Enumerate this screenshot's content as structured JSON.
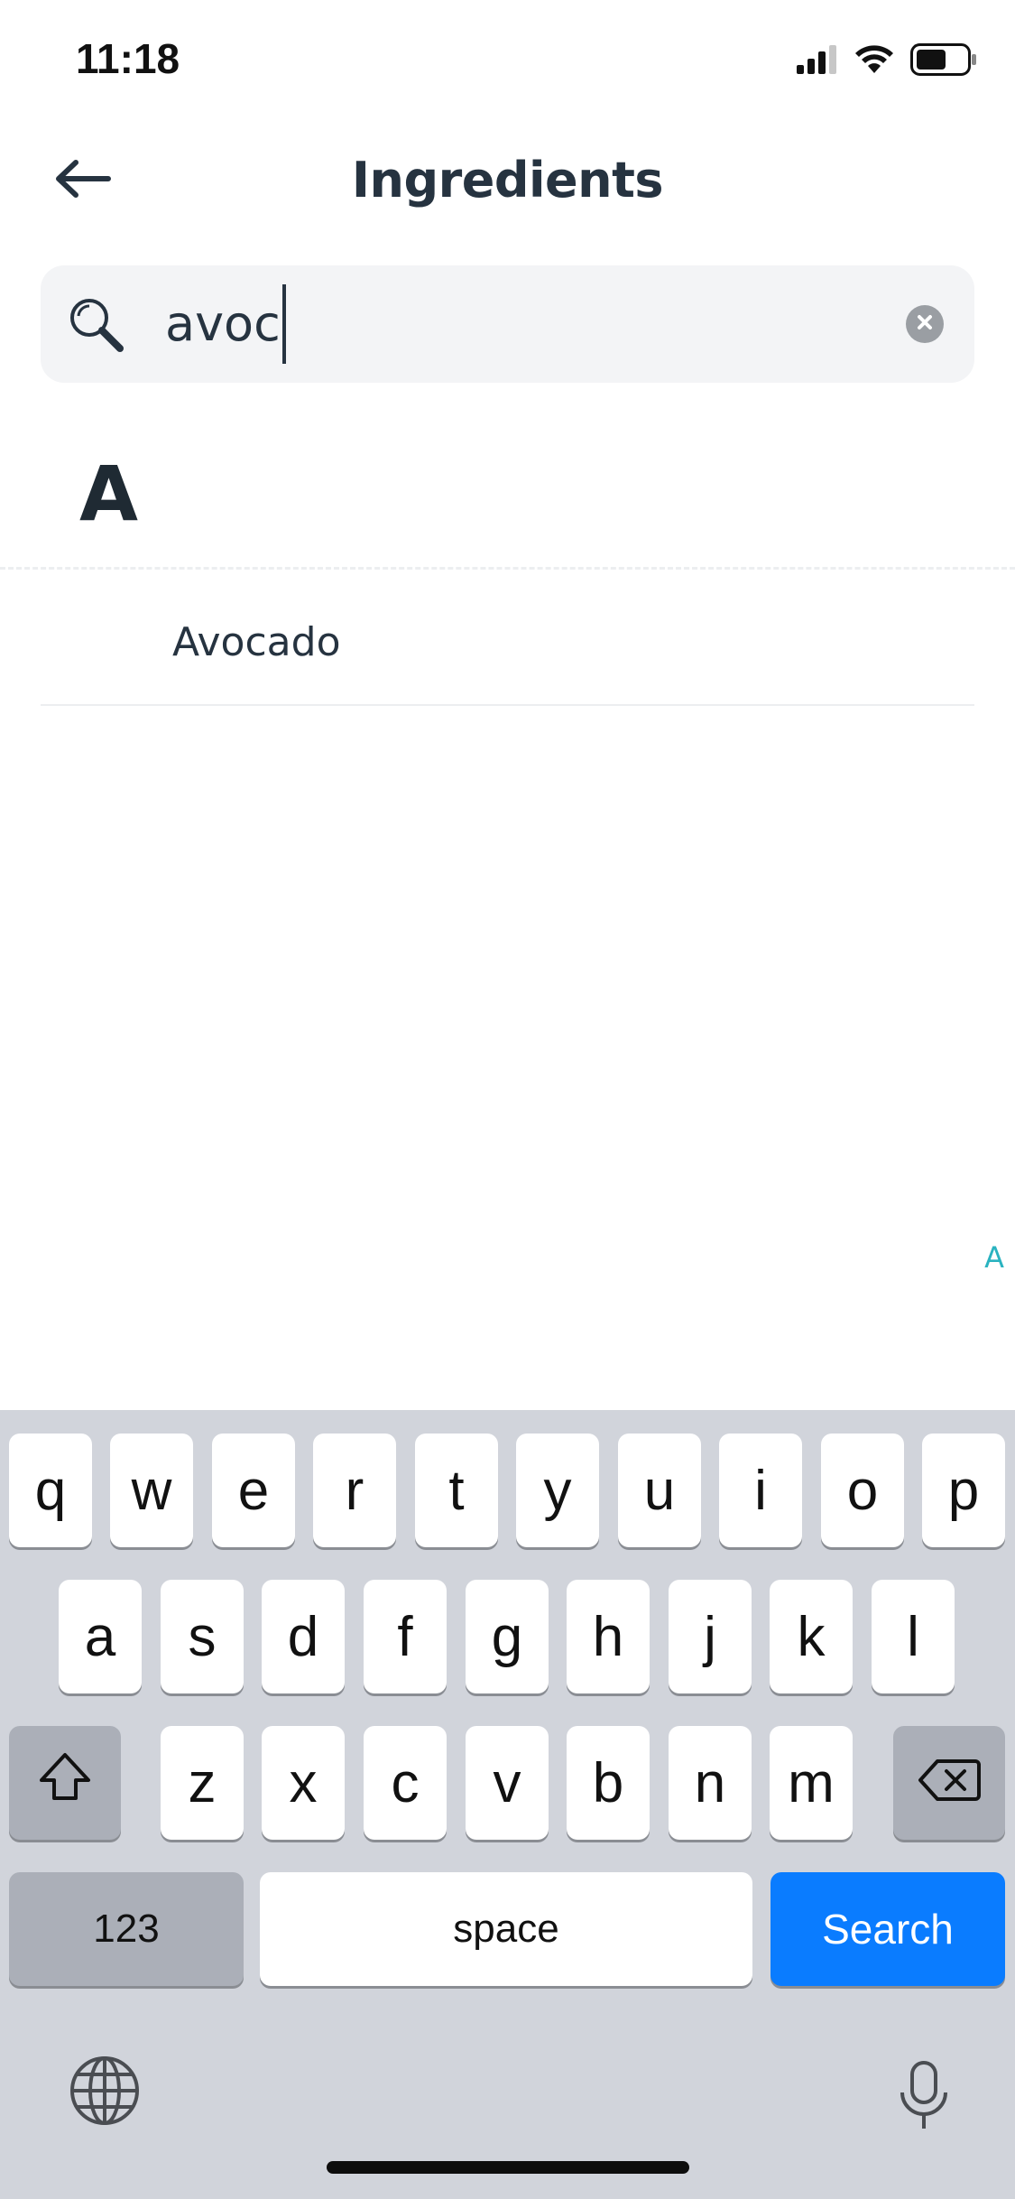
{
  "status_bar": {
    "time": "11:18"
  },
  "header": {
    "title": "Ingredients"
  },
  "search": {
    "value": "avoc"
  },
  "list": {
    "section_letter": "A",
    "items": [
      {
        "label": "Avocado"
      }
    ],
    "index_letters": [
      "A"
    ]
  },
  "keyboard": {
    "row1": [
      "q",
      "w",
      "e",
      "r",
      "t",
      "y",
      "u",
      "i",
      "o",
      "p"
    ],
    "row2": [
      "a",
      "s",
      "d",
      "f",
      "g",
      "h",
      "j",
      "k",
      "l"
    ],
    "row3": [
      "z",
      "x",
      "c",
      "v",
      "b",
      "n",
      "m"
    ],
    "numbers_label": "123",
    "space_label": "space",
    "search_label": "Search"
  },
  "colors": {
    "accent": "#0a7cff",
    "index_accent": "#2ab3c0",
    "keyboard_bg": "#d1d4db",
    "search_bg": "#f3f4f6"
  }
}
